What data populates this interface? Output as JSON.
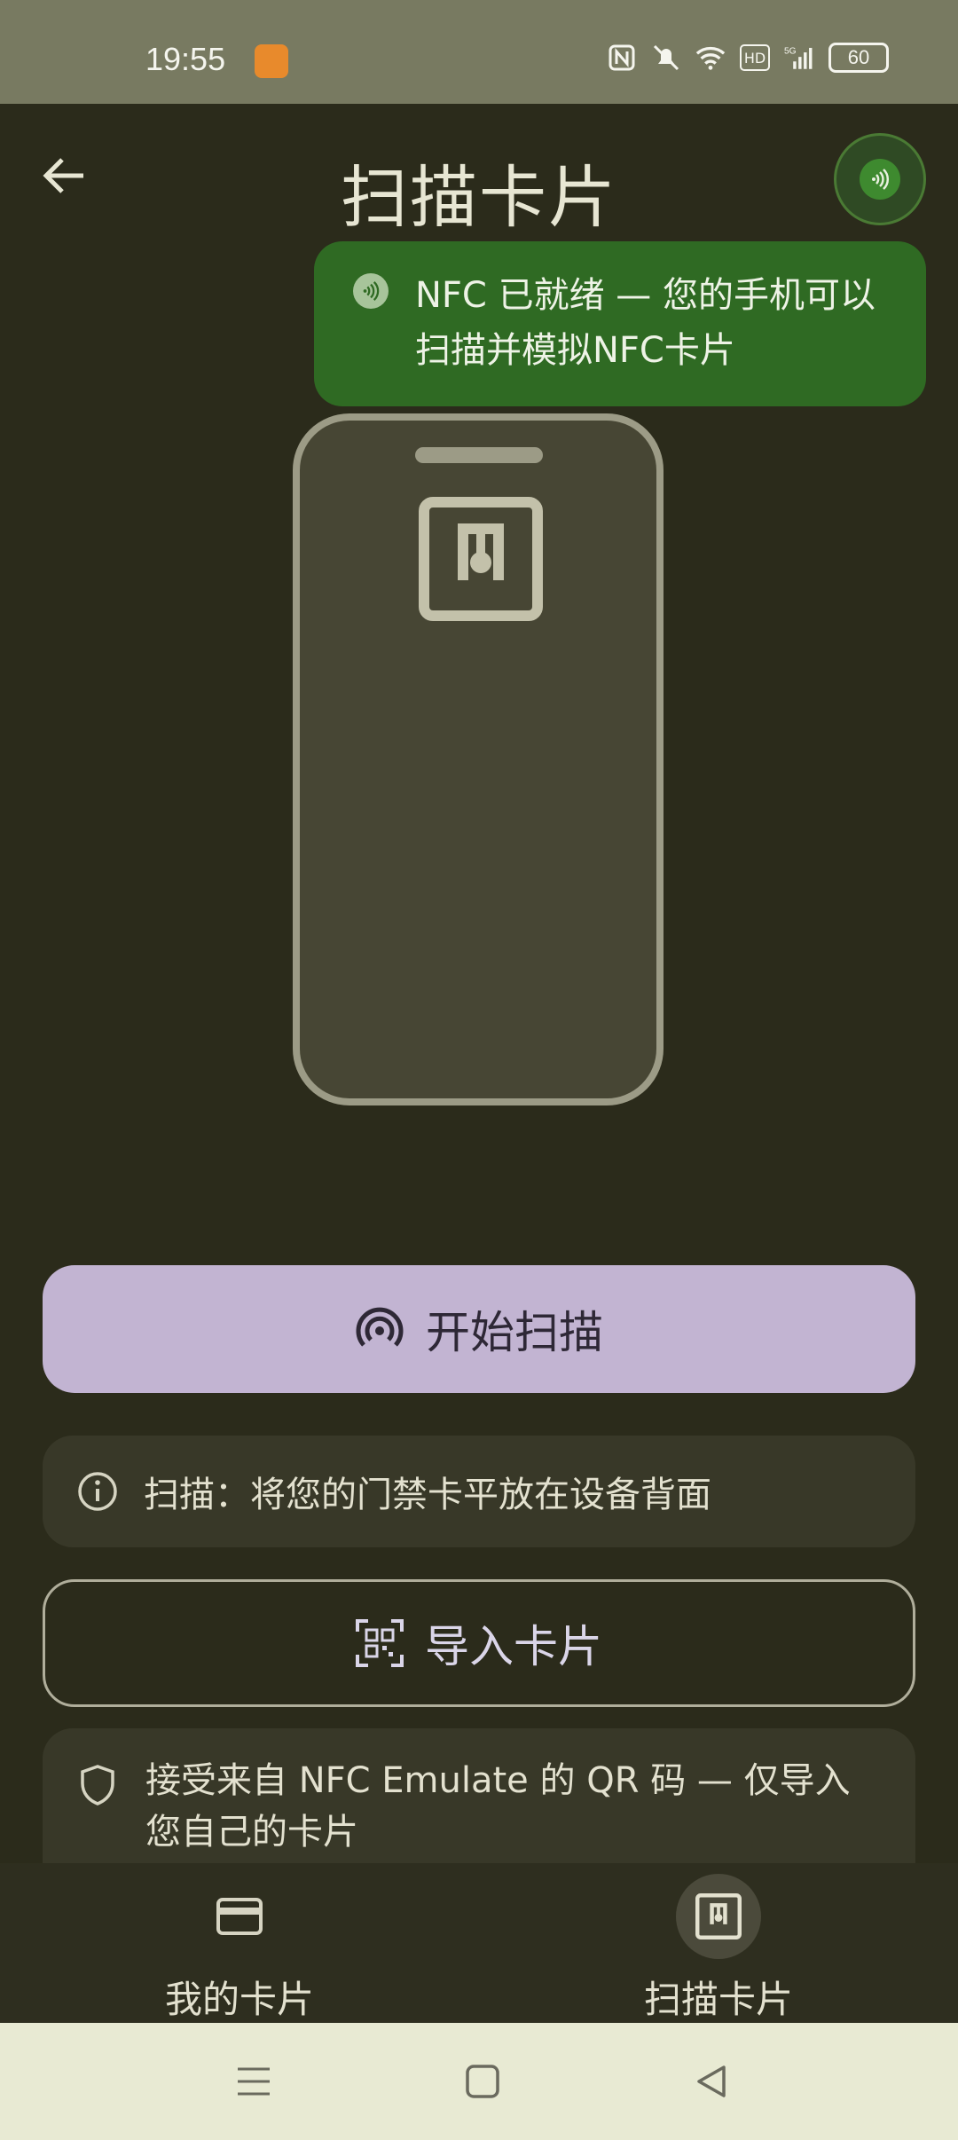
{
  "status_bar": {
    "time": "19:55",
    "battery": "60",
    "network": "5G",
    "hd_label": "HD"
  },
  "header": {
    "title": "扫描卡片"
  },
  "toast": {
    "message": "NFC 已就绪 — 您的手机可以扫描并模拟NFC卡片"
  },
  "actions": {
    "start_scan_label": "开始扫描",
    "scan_hint": "扫描：将您的门禁卡平放在设备背面",
    "import_label": "导入卡片",
    "qr_notice": "接受来自 NFC Emulate 的 QR 码 — 仅导入您自己的卡片"
  },
  "bottom_nav": {
    "items": [
      {
        "label": "我的卡片",
        "icon": "card-icon",
        "active": false
      },
      {
        "label": "扫描卡片",
        "icon": "nfc-icon",
        "active": true
      }
    ]
  },
  "colors": {
    "background": "#2b2b1b",
    "toast": "#2f6a23",
    "primary_button": "#c2b4d2",
    "status_bar": "#787a61"
  }
}
